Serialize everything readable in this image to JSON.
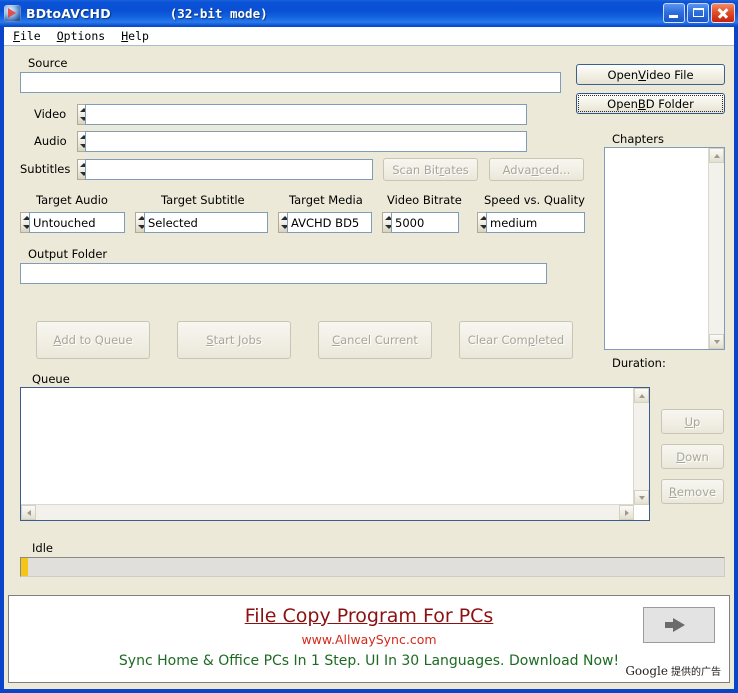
{
  "window": {
    "title": "BDtoAVCHD",
    "mode": "(32-bit mode)",
    "icon": "app-icon",
    "minimize_label": "Minimize",
    "maximize_label": "Maximize",
    "close_label": "Close"
  },
  "menu": [
    {
      "label": "File",
      "accel": "F"
    },
    {
      "label": "Options",
      "accel": "O"
    },
    {
      "label": "Help",
      "accel": "H"
    }
  ],
  "source": {
    "label": "Source",
    "value": "",
    "rows": [
      {
        "label": "Video",
        "value": ""
      },
      {
        "label": "Audio",
        "value": ""
      },
      {
        "label": "Subtitles",
        "value": ""
      }
    ]
  },
  "buttons": {
    "open_video_file": {
      "pre": "Open ",
      "accel": "V",
      "post": "ideo File"
    },
    "open_bd_folder": {
      "pre": "Open ",
      "accel": "B",
      "post": "D Folder"
    },
    "scan_bitrates": {
      "pre": "Scan Bit",
      "accel": "r",
      "post": "ates"
    },
    "advanced": {
      "pre": "Adva",
      "accel": "n",
      "post": "ced..."
    },
    "add_to_queue": {
      "pre": "",
      "accel": "A",
      "post": "dd to Queue"
    },
    "start_jobs": {
      "pre": "",
      "accel": "S",
      "post": "tart Jobs"
    },
    "cancel_current": {
      "pre": "",
      "accel": "C",
      "post": "ancel Current"
    },
    "clear_completed": {
      "pre": "Clear Com",
      "accel": "p",
      "post": "leted"
    },
    "up": {
      "pre": "",
      "accel": "U",
      "post": "p"
    },
    "down": {
      "pre": "",
      "accel": "D",
      "post": "own"
    },
    "remove": {
      "pre": "",
      "accel": "R",
      "post": "emove"
    }
  },
  "settings": [
    {
      "label": "Target Audio",
      "value": "Untouched"
    },
    {
      "label": "Target Subtitle",
      "value": "Selected"
    },
    {
      "label": "Target Media",
      "value": "AVCHD BD5"
    },
    {
      "label": "Video Bitrate",
      "value": "5000"
    },
    {
      "label": "Speed vs. Quality",
      "value": "medium"
    }
  ],
  "output_folder": {
    "label": "Output Folder",
    "value": ""
  },
  "chapters": {
    "label": "Chapters",
    "items": [],
    "duration_label": "Duration:"
  },
  "queue": {
    "label": "Queue",
    "items": []
  },
  "status": {
    "label": "Idle",
    "progress_percent": 1
  },
  "ad": {
    "headline": "File Copy Program For PCs",
    "url": "www.AllwaySync.com",
    "description": "Sync Home & Office PCs In 1 Step. UI In 30 Languages. Download Now!",
    "credit_brand": "Google",
    "credit_text": "提供的广告"
  },
  "colors": {
    "titlebar": "#0a4fd4",
    "client": "#ece9d8",
    "input_border": "#7f9db9",
    "progress_fill": "#f5c518",
    "ad_headline": "#8c1111",
    "ad_url": "#d42a1a",
    "ad_desc": "#1d6b22"
  }
}
